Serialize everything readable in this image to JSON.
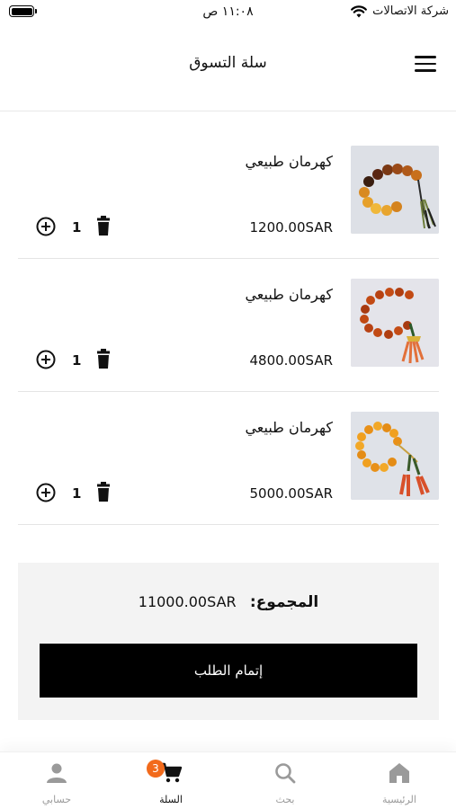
{
  "status_bar": {
    "carrier": "شركة الاتصالات",
    "time": "١١:٠٨ ص"
  },
  "header": {
    "title": "سلة التسوق"
  },
  "cart": {
    "items": [
      {
        "name": "كهرمان طبيعي",
        "price": "1200.00SAR",
        "quantity": "1"
      },
      {
        "name": "كهرمان طبيعي",
        "price": "4800.00SAR",
        "quantity": "1"
      },
      {
        "name": "كهرمان طبيعي",
        "price": "5000.00SAR",
        "quantity": "1"
      }
    ]
  },
  "summary": {
    "total_label": "المجموع:",
    "total_value": "11000.00SAR",
    "checkout_label": "إتمام الطلب"
  },
  "bottom_nav": {
    "account_label": "حسابي",
    "cart_label": "السلة",
    "cart_badge": "3",
    "search_label": "بحث",
    "home_label": "الرئيسية"
  },
  "colors": {
    "badge": "#f26a1b",
    "inactive_icon": "#9a9a9a",
    "checkout_bg": "#000000"
  }
}
